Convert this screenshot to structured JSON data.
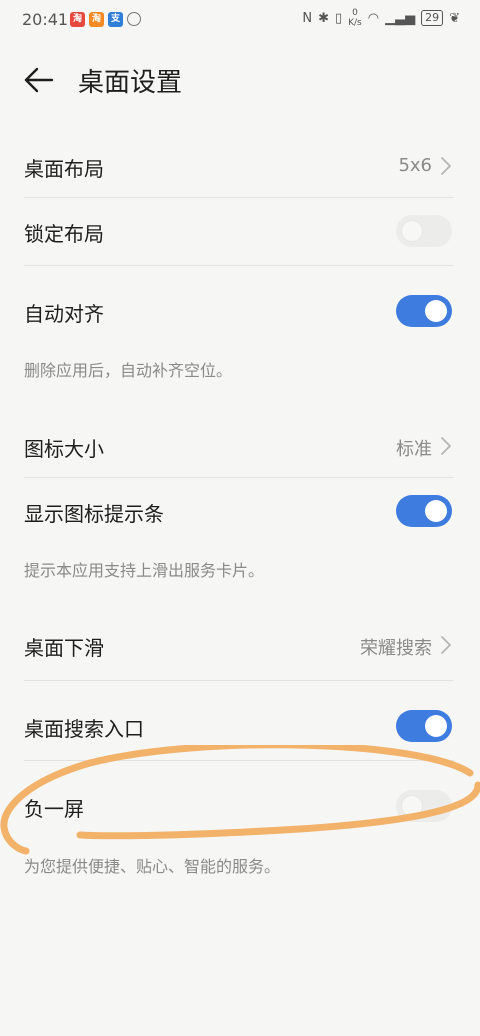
{
  "status_bar": {
    "time": "20:41",
    "apps": [
      "tb",
      "tao",
      "zfb",
      "cir"
    ],
    "speed_value": "0",
    "speed_unit": "K/s",
    "battery": "29"
  },
  "header": {
    "title": "桌面设置"
  },
  "settings": {
    "layout": {
      "label": "桌面布局",
      "value": "5x6"
    },
    "lock_layout": {
      "label": "锁定布局",
      "state": "off"
    },
    "auto_align": {
      "label": "自动对齐",
      "state": "on",
      "description": "删除应用后，自动补齐空位。"
    },
    "icon_size": {
      "label": "图标大小",
      "value": "标准"
    },
    "show_icon_hint": {
      "label": "显示图标提示条",
      "state": "on",
      "description": "提示本应用支持上滑出服务卡片。"
    },
    "desktop_swipe": {
      "label": "桌面下滑",
      "value": "荣耀搜索"
    },
    "search_entry": {
      "label": "桌面搜索入口",
      "state": "on"
    },
    "minus_one_screen": {
      "label": "负一屏",
      "state": "off",
      "description": "为您提供便捷、贴心、智能的服务。"
    }
  },
  "colors": {
    "accent": "#3e7ce0",
    "annotation": "#f2b26a"
  }
}
